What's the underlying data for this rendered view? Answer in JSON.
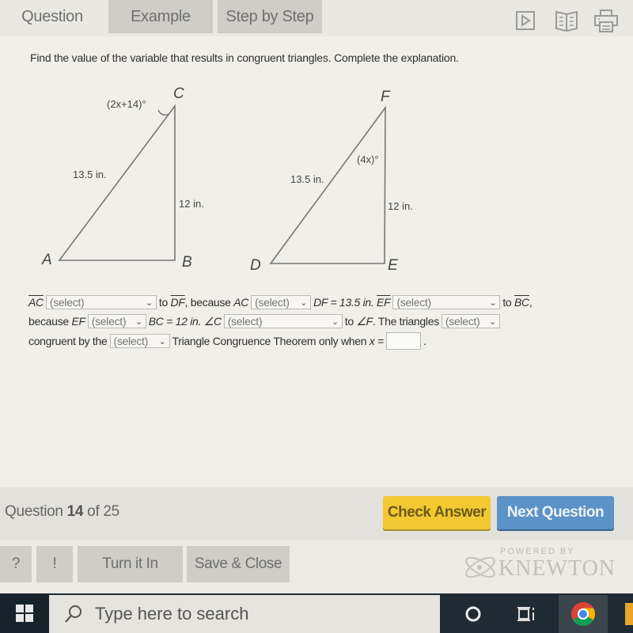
{
  "tabs": [
    {
      "label": "Question",
      "active": true
    },
    {
      "label": "Example",
      "active": false
    },
    {
      "label": "Step by Step",
      "active": false
    }
  ],
  "toolbar_icons": [
    "play-icon",
    "book-icon",
    "print-icon"
  ],
  "question": {
    "prompt": "Find the value of the variable that results in congruent triangles. Complete the explanation.",
    "figure": {
      "triangle1": {
        "vertices": {
          "A": "A",
          "B": "B",
          "C": "C"
        },
        "angle_label": "(2x+14)°",
        "hypotenuse_label": "13.5 in.",
        "leg_label": "12 in."
      },
      "triangle2": {
        "vertices": {
          "D": "D",
          "E": "E",
          "F": "F"
        },
        "angle_label": "(4x)°",
        "hypotenuse_label": "13.5 in.",
        "leg_label": "12 in."
      }
    },
    "explanation": {
      "line1": {
        "seg_ac": "AC",
        "sel1": "(select)",
        "t1": "to",
        "seg_df": "DF",
        "t2": ", because",
        "ac": "AC",
        "sel2": "(select)",
        "t3": "DF = 13.5 in.",
        "seg_ef": "EF",
        "sel3": "(select)",
        "t4": "to",
        "seg_bc": "BC",
        "t5": ","
      },
      "line2": {
        "t1": "because",
        "ef": "EF",
        "sel4": "(select)",
        "t2": "BC = 12 in.",
        "angle_c": "∠C",
        "sel5": "(select)",
        "t3": "to",
        "angle_f": "∠F",
        "t4": ". The triangles",
        "sel6": "(select)"
      },
      "line3": {
        "t1": "congruent by the",
        "sel7": "(select)",
        "t2": "Triangle Congruence Theorem only when",
        "x": "x",
        "t3": "=",
        "answer_value": "",
        "t4": "."
      }
    }
  },
  "footer": {
    "question_label": "Question",
    "question_number": "14",
    "of_label": "of 25",
    "check_answer": "Check Answer",
    "next_question": "Next Question"
  },
  "bottom_buttons": {
    "help": "?",
    "alert": "!",
    "turn_in": "Turn it In",
    "save_close": "Save & Close"
  },
  "branding": {
    "powered_by": "POWERED BY",
    "name": "KNEWTON"
  },
  "taskbar": {
    "search_placeholder": "Type here to search"
  },
  "colors": {
    "check_answer": "#f2c932",
    "next_question": "#5b92c8",
    "taskbar": "#1f2b33"
  }
}
